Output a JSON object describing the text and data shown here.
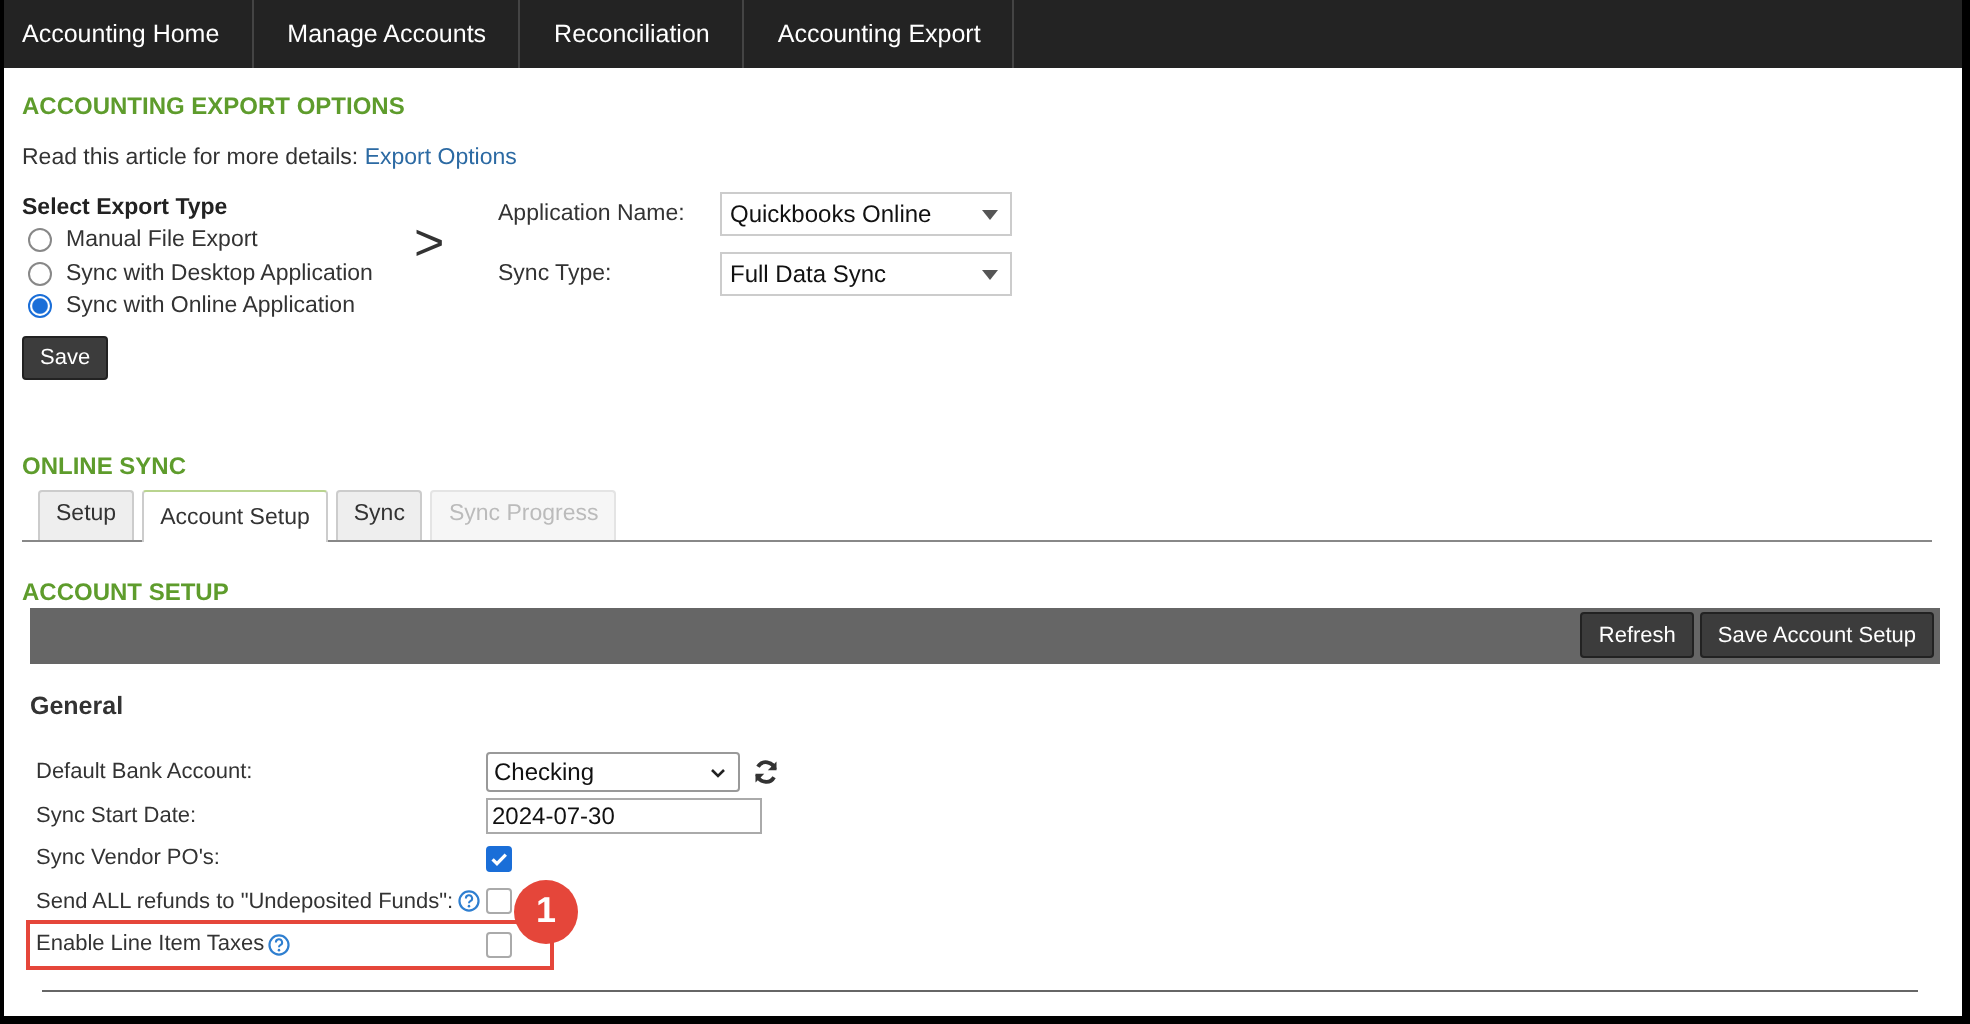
{
  "nav": [
    "Accounting Home",
    "Manage Accounts",
    "Reconciliation",
    "Accounting Export"
  ],
  "export_options": {
    "title": "ACCOUNTING EXPORT OPTIONS",
    "intro": "Read this article for more details:",
    "link": "Export Options",
    "type_label": "Select Export Type",
    "types": [
      {
        "label": "Manual File Export",
        "selected": false
      },
      {
        "label": "Sync with Desktop Application",
        "selected": false
      },
      {
        "label": "Sync with Online Application",
        "selected": true
      }
    ],
    "arrow": ">",
    "settings": [
      {
        "label": "Application Name:",
        "value": "Quickbooks Online"
      },
      {
        "label": "Sync Type:",
        "value": "Full Data Sync"
      }
    ],
    "save": "Save"
  },
  "online_sync": {
    "title": "ONLINE SYNC",
    "tabs": [
      {
        "label": "Setup",
        "selected": false,
        "disabled": false
      },
      {
        "label": "Account Setup",
        "selected": true,
        "disabled": false
      },
      {
        "label": "Sync",
        "selected": false,
        "disabled": false
      },
      {
        "label": "Sync Progress",
        "selected": false,
        "disabled": true
      }
    ]
  },
  "account_setup": {
    "title": "ACCOUNT SETUP",
    "buttons": [
      "Refresh",
      "Save Account Setup"
    ],
    "section": "General",
    "fields": [
      {
        "kind": "select",
        "label": "Default Bank Account:",
        "value": "Checking",
        "refresh": true
      },
      {
        "kind": "date",
        "label": "Sync Start Date:",
        "value": "2024-07-30"
      },
      {
        "kind": "checkbox",
        "label": "Sync Vendor PO's:",
        "checked": true
      },
      {
        "kind": "checkbox",
        "label": "Send ALL refunds to \"Undeposited Funds\":",
        "checked": false,
        "help": true
      },
      {
        "kind": "checkbox",
        "label": "Enable Line Item Taxes",
        "checked": false,
        "help": true,
        "highlighted": true,
        "callout": "1"
      }
    ]
  }
}
